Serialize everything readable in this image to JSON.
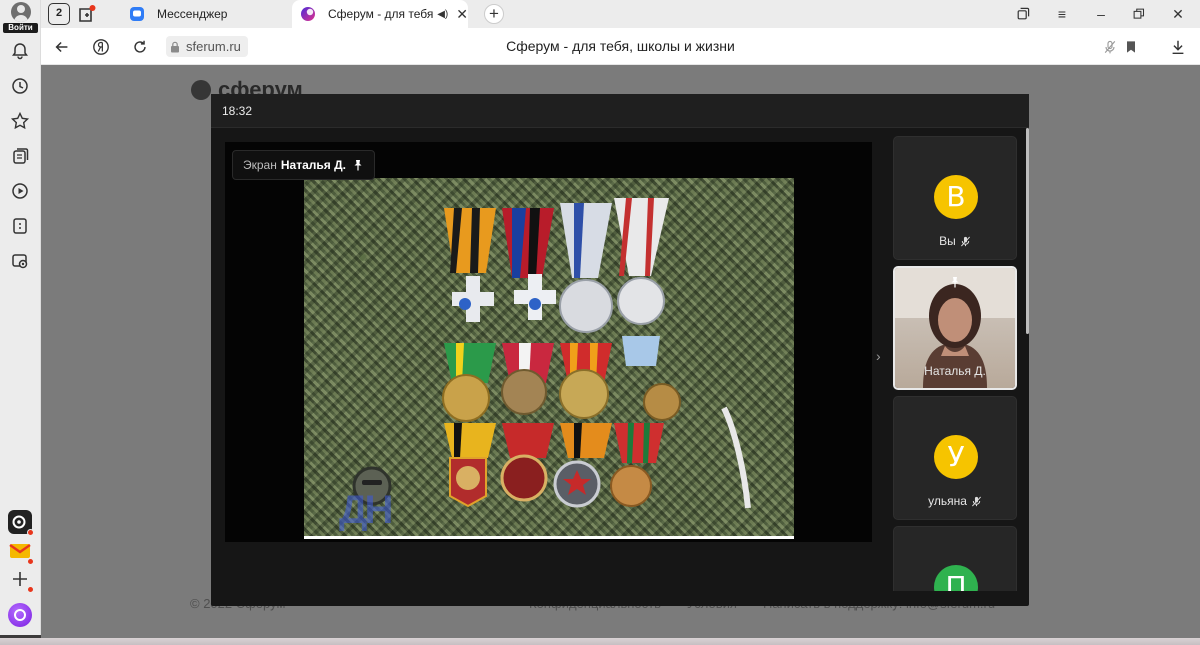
{
  "sidebar": {
    "login_label": "Войти",
    "icons": [
      "bell-icon",
      "history-icon",
      "star-icon",
      "collections-icon",
      "video-icon",
      "notes-icon",
      "screenshot-icon"
    ],
    "apps": [
      "alice-camera-app",
      "mail-app",
      "add-app",
      "alice-assistant-app"
    ]
  },
  "tabs": {
    "count": "2",
    "messenger_title": "Мессенджер",
    "active_title": "Сферум - для тебя, ш",
    "active_audio_icon": "speaker-icon"
  },
  "addressbar": {
    "url": "sferum.ru",
    "page_title": "Сферум - для тебя, школы и жизни"
  },
  "page": {
    "logo_text": "сферум",
    "footer_copyright": "© 2022 Сферум",
    "footer_links": [
      "Конфиденциальность",
      "Условия",
      "Написать в поддержку: info@sferum.ru"
    ]
  },
  "call": {
    "time": "18:32",
    "screen_label_prefix": "Экран",
    "screen_label_name": "Наталья Д.",
    "watermark": "ДН",
    "participants": [
      {
        "initial": "В",
        "name": "Вы",
        "color": "#f6c400",
        "muted": true
      },
      {
        "name": "Наталья Д.",
        "video": true,
        "pinned": true
      },
      {
        "initial": "У",
        "name": "ульяна",
        "color": "#f6c400",
        "muted": true
      },
      {
        "initial": "П",
        "name": "",
        "color": "#2fb24f",
        "muted": false
      }
    ]
  },
  "colors": {
    "accent_yellow": "#f6c400",
    "accent_green": "#2fb24f",
    "sferum_gradient": [
      "#4b2bd9",
      "#e0328c"
    ]
  }
}
